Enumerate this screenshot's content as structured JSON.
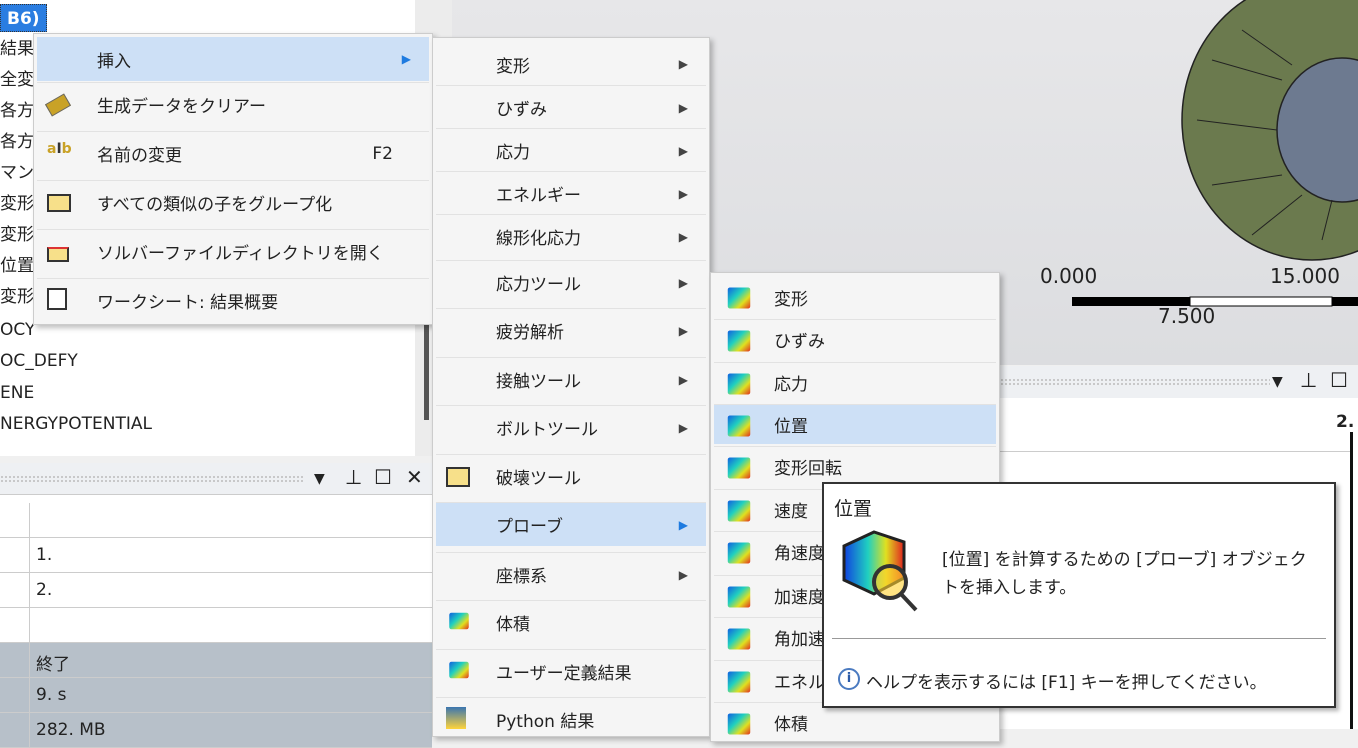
{
  "tree": {
    "selected": "B6)",
    "items": [
      "結果",
      "全変",
      "各方",
      "各方",
      "マン",
      "変形",
      "変形",
      "位置",
      "変形",
      "OCY",
      "OC_DEFY",
      "ENE",
      "NERGYPOTENTIAL"
    ]
  },
  "viewport": {
    "scale_labels": [
      "0.000",
      "15.000",
      "7.500"
    ],
    "model_color": "#6b7a4e"
  },
  "lower_panel": {
    "rows": [
      {
        "v": "",
        "g": false
      },
      {
        "v": "1.",
        "g": false
      },
      {
        "v": "2.",
        "g": false
      },
      {
        "v": "",
        "g": false
      },
      {
        "v": "終了",
        "g": true
      },
      {
        "v": "9. s",
        "g": true
      },
      {
        "v": "282. MB",
        "g": true
      }
    ]
  },
  "right_panel": {
    "value": "2."
  },
  "context_menu": {
    "items": [
      {
        "label": "挿入",
        "icon": "none",
        "arrow": true,
        "hl": true
      },
      {
        "label": "生成データをクリアー",
        "icon": "eraser-icon"
      },
      {
        "label": "名前の変更",
        "icon": "rename-icon",
        "shortcut": "F2"
      },
      {
        "label": "すべての類似の子をグループ化",
        "icon": "folder-icon"
      },
      {
        "label": "ソルバーファイルディレクトリを開く",
        "icon": "folder-open-icon"
      },
      {
        "label": "ワークシート: 結果概要",
        "icon": "worksheet-icon"
      }
    ]
  },
  "insert_menu": {
    "items": [
      {
        "label": "変形",
        "arrow": true
      },
      {
        "label": "ひずみ",
        "arrow": true
      },
      {
        "label": "応力",
        "arrow": true
      },
      {
        "label": "エネルギー",
        "arrow": true
      },
      {
        "label": "線形化応力",
        "arrow": true
      },
      {
        "label": "応力ツール",
        "arrow": true
      },
      {
        "label": "疲労解析",
        "arrow": true
      },
      {
        "label": "接触ツール",
        "arrow": true
      },
      {
        "label": "ボルトツール",
        "arrow": true
      },
      {
        "label": "破壊ツール",
        "icon": "fracture-tool-icon"
      },
      {
        "label": "プローブ",
        "arrow": true,
        "hl": true
      },
      {
        "label": "座標系",
        "arrow": true
      },
      {
        "label": "体積",
        "icon": "volume-icon"
      },
      {
        "label": "ユーザー定義結果",
        "icon": "user-defined-result-icon"
      },
      {
        "label": "Python 結果",
        "icon": "python-icon"
      }
    ]
  },
  "probe_menu": {
    "items": [
      {
        "label": "変形"
      },
      {
        "label": "ひずみ"
      },
      {
        "label": "応力"
      },
      {
        "label": "位置",
        "hl": true
      },
      {
        "label": "変形回転"
      },
      {
        "label": "速度"
      },
      {
        "label": "角速度"
      },
      {
        "label": "加速度"
      },
      {
        "label": "角加速度"
      },
      {
        "label": "エネルギー"
      },
      {
        "label": "体積"
      }
    ]
  },
  "tooltip": {
    "title": "位置",
    "description": "[位置] を計算するための [プローブ] オブジェクトを挿入します。",
    "help": "ヘルプを表示するには [F1] キーを押してください。"
  }
}
